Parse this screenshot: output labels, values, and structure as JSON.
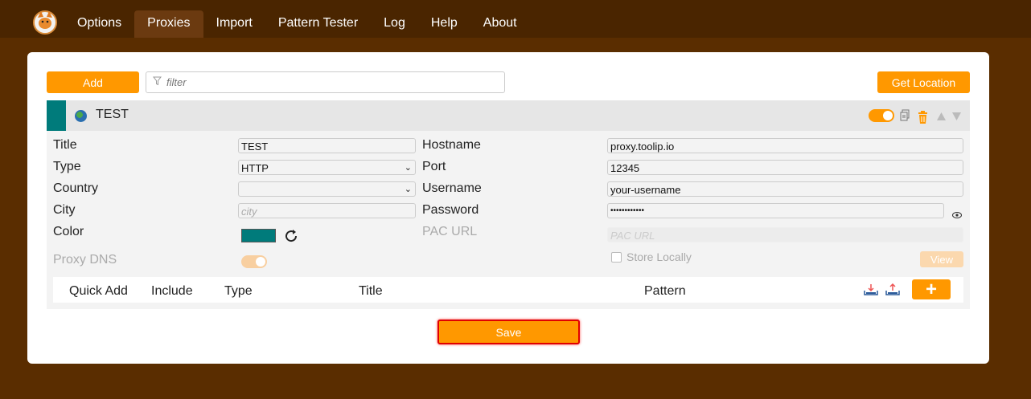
{
  "nav": {
    "tabs": [
      {
        "label": "Options"
      },
      {
        "label": "Proxies"
      },
      {
        "label": "Import"
      },
      {
        "label": "Pattern Tester"
      },
      {
        "label": "Log"
      },
      {
        "label": "Help"
      },
      {
        "label": "About"
      }
    ],
    "active_tab": "Proxies"
  },
  "toolbar": {
    "add_label": "Add",
    "filter_placeholder": "filter",
    "get_location_label": "Get Location"
  },
  "proxy": {
    "header_title": "TEST",
    "color": "#007b7b",
    "enabled": true,
    "fields": {
      "title_label": "Title",
      "title_value": "TEST",
      "type_label": "Type",
      "type_value": "HTTP",
      "country_label": "Country",
      "country_value": "",
      "city_label": "City",
      "city_placeholder": "city",
      "color_label": "Color",
      "proxy_dns_label": "Proxy DNS",
      "hostname_label": "Hostname",
      "hostname_value": "proxy.toolip.io",
      "port_label": "Port",
      "port_value": "12345",
      "username_label": "Username",
      "username_value": "your-username",
      "password_label": "Password",
      "password_value": "••••••••••••",
      "pac_url_label": "PAC URL",
      "pac_url_placeholder": "PAC URL",
      "store_locally_label": "Store Locally",
      "view_label": "View"
    },
    "patterns_header": {
      "quick_add": "Quick Add",
      "include": "Include",
      "type": "Type",
      "title": "Title",
      "pattern": "Pattern",
      "add_label": "+"
    }
  },
  "footer": {
    "save_label": "Save"
  },
  "colors": {
    "accent": "#ff9800",
    "brand_bg": "#5a2d00",
    "proxy_color": "#007b7b",
    "save_outline": "#e00000"
  }
}
